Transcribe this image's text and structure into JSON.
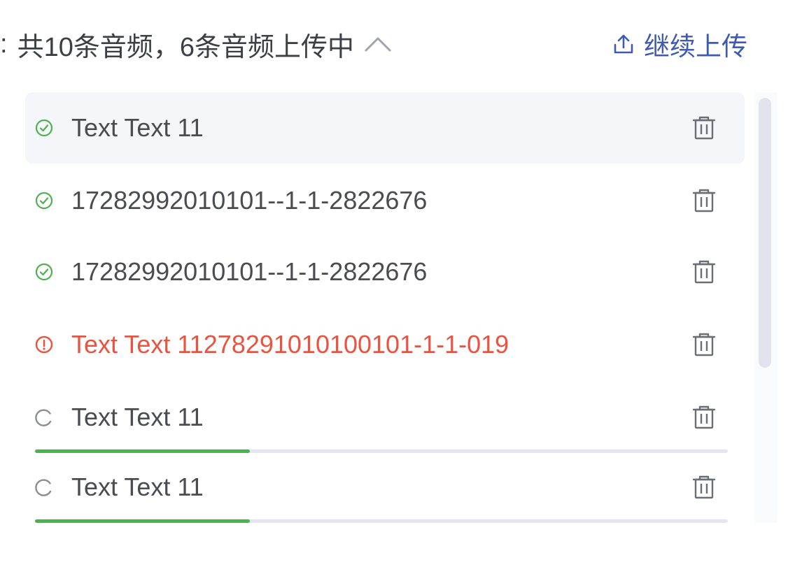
{
  "header": {
    "colon": ":",
    "summary": "共10条音频，6条音频上传中",
    "collapse_icon": "chevron-up-icon",
    "continue_upload_label": "继续上传",
    "continue_upload_icon": "upload-icon"
  },
  "files": [
    {
      "name": "Text Text 11",
      "status": "success",
      "status_icon": "check-circle-icon",
      "hover": true
    },
    {
      "name": "17282992010101--1-1-2822676",
      "status": "success",
      "status_icon": "check-circle-icon"
    },
    {
      "name": "17282992010101--1-1-2822676",
      "status": "success",
      "status_icon": "check-circle-icon"
    },
    {
      "name": "Text Text 1127829101010010​1-1-1-019",
      "status": "error",
      "status_icon": "exclamation-circle-icon"
    },
    {
      "name": "Text Text 11",
      "status": "uploading",
      "status_icon": "loading-icon",
      "progress": 0.31
    },
    {
      "name": "Text Text 11",
      "status": "uploading",
      "status_icon": "loading-icon",
      "progress": 0.31
    }
  ],
  "colors": {
    "success": "#4fb04f",
    "error": "#e8543f",
    "accent": "#3f5bb0",
    "text": "#4a4c52",
    "muted": "#909399"
  },
  "delete_icon": "trash-icon"
}
